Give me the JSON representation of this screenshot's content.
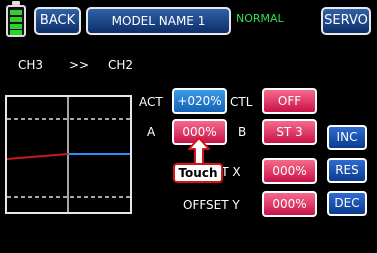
{
  "header": {
    "back_label": "BACK",
    "model_name": "MODEL NAME   1",
    "mode": "NORMAL",
    "servo_label": "SERVO"
  },
  "channel": {
    "from": "CH3",
    "separator": ">>",
    "to": "CH2"
  },
  "settings": {
    "act_label": "ACT",
    "act_value": "+020%",
    "ctl_label": "CTL",
    "ctl_value": "OFF",
    "a_label": "A",
    "a_value": "000%",
    "b_label": "B",
    "b_value": "ST 3",
    "offset_x_label": "OFFSET X",
    "offset_x_value": "000%",
    "offset_y_label": "OFFSET Y",
    "offset_y_value": "000%"
  },
  "side_buttons": {
    "inc": "INC",
    "res": "RES",
    "dec": "DEC"
  },
  "callout": {
    "label": "Touch"
  },
  "colors": {
    "mode_text": "#2ee04a",
    "blue_box": "#1a72c8",
    "red_box": "#d81b55",
    "curve_left": "#c81a1a",
    "curve_right": "#2a8cff"
  }
}
